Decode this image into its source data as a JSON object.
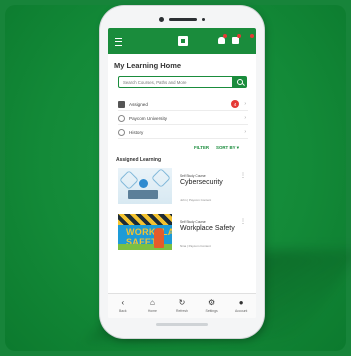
{
  "page": {
    "title": "My Learning Home"
  },
  "search": {
    "placeholder": "Search Courses, Paths and More"
  },
  "menu_rows": [
    {
      "label": "Assigned",
      "badge": "4"
    },
    {
      "label": "Paycom University"
    },
    {
      "label": "History"
    }
  ],
  "filters": {
    "filter_label": "FILTER",
    "sort_label": "SORT BY ▾"
  },
  "section": {
    "title": "Assigned Learning"
  },
  "courses": [
    {
      "type": "Self Study Course",
      "title": "Cybersecurity",
      "author": "John | Paycom Content"
    },
    {
      "type": "Self Study Course",
      "title": "Workplace Safety",
      "author": "Nina | Paycom Content",
      "thumb_text": "WORKPLACE SAFETY"
    }
  ],
  "bottom_nav": [
    {
      "glyph": "‹",
      "label": "Back"
    },
    {
      "glyph": "⌂",
      "label": "Home"
    },
    {
      "glyph": "↻",
      "label": "Refresh"
    },
    {
      "glyph": "⚙",
      "label": "Settings"
    },
    {
      "glyph": "●",
      "label": "Account"
    }
  ],
  "colors": {
    "brand_green": "#1a8c3c",
    "background_green": "#17843a",
    "badge_red": "#e53935"
  }
}
